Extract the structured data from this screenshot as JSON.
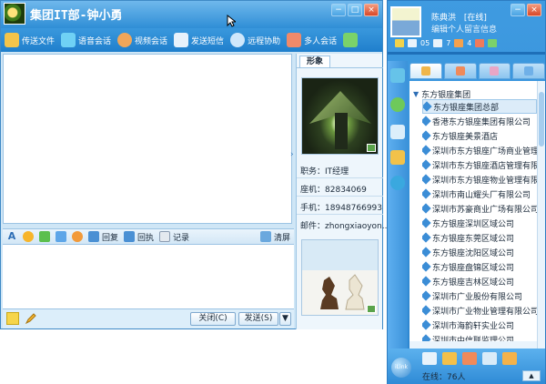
{
  "chat": {
    "title": "集团IT部-钟小勇",
    "toolbar": [
      {
        "label": "传送文件",
        "icon": "file-transfer-icon",
        "color": "#f3c44b"
      },
      {
        "label": "语音会话",
        "icon": "microphone-icon",
        "color": "#6fd1f5"
      },
      {
        "label": "视频会话",
        "icon": "video-icon",
        "color": "#f0a65a"
      },
      {
        "label": "发送短信",
        "icon": "sms-icon",
        "color": "#e7f1fb"
      },
      {
        "label": "远程协助",
        "icon": "remote-assist-icon",
        "color": "#cfe7fb"
      },
      {
        "label": "多人会话",
        "icon": "multi-chat-icon",
        "color": "#f08a6a"
      }
    ],
    "input_toolbar": {
      "reply": "回复",
      "receipt": "回执",
      "history": "记录",
      "clear": "清屏"
    },
    "buttons": {
      "close": "关闭(C)",
      "send": "发送(S)",
      "send_menu": "▼"
    }
  },
  "profile": {
    "tab": "形象",
    "fields": [
      {
        "label": "职务：",
        "value": "IT经理"
      },
      {
        "label": "座机：",
        "value": "82834069"
      },
      {
        "label": "手机：",
        "value": "18948766993"
      },
      {
        "label": "邮件：",
        "value": "zhongxiaoyon..."
      }
    ]
  },
  "me": {
    "name": "陈典洪",
    "status": "[在线]",
    "signature": "编辑个人留言信息",
    "counts": [
      "05",
      "7",
      "4"
    ]
  },
  "contacts": {
    "root": "东方银座集团",
    "items": [
      "东方银座集团总部",
      "香港东方银座集团有限公司",
      "东方银座美景酒店",
      "深圳市东方银座广场商业管理",
      "深圳市东方银座酒店管理有限",
      "深圳市东方银座物业管理有限",
      "深圳市南山耀头厂有限公司",
      "深圳市苏豪商业广场有限公司",
      "东方银座深圳区域公司",
      "东方银座东莞区域公司",
      "东方银座沈阳区域公司",
      "东方银座盘锦区域公司",
      "东方银座吉林区域公司",
      "深圳市广业股份有限公司",
      "深圳市广业物业管理有限公司",
      "深圳市海韵轩实业公司",
      "深圳市中信联监理公司"
    ],
    "online": "在线：76人",
    "logo": "iLink"
  },
  "colors": {
    "accent": "#2f8ed6",
    "panel": "#cfe6f6"
  }
}
